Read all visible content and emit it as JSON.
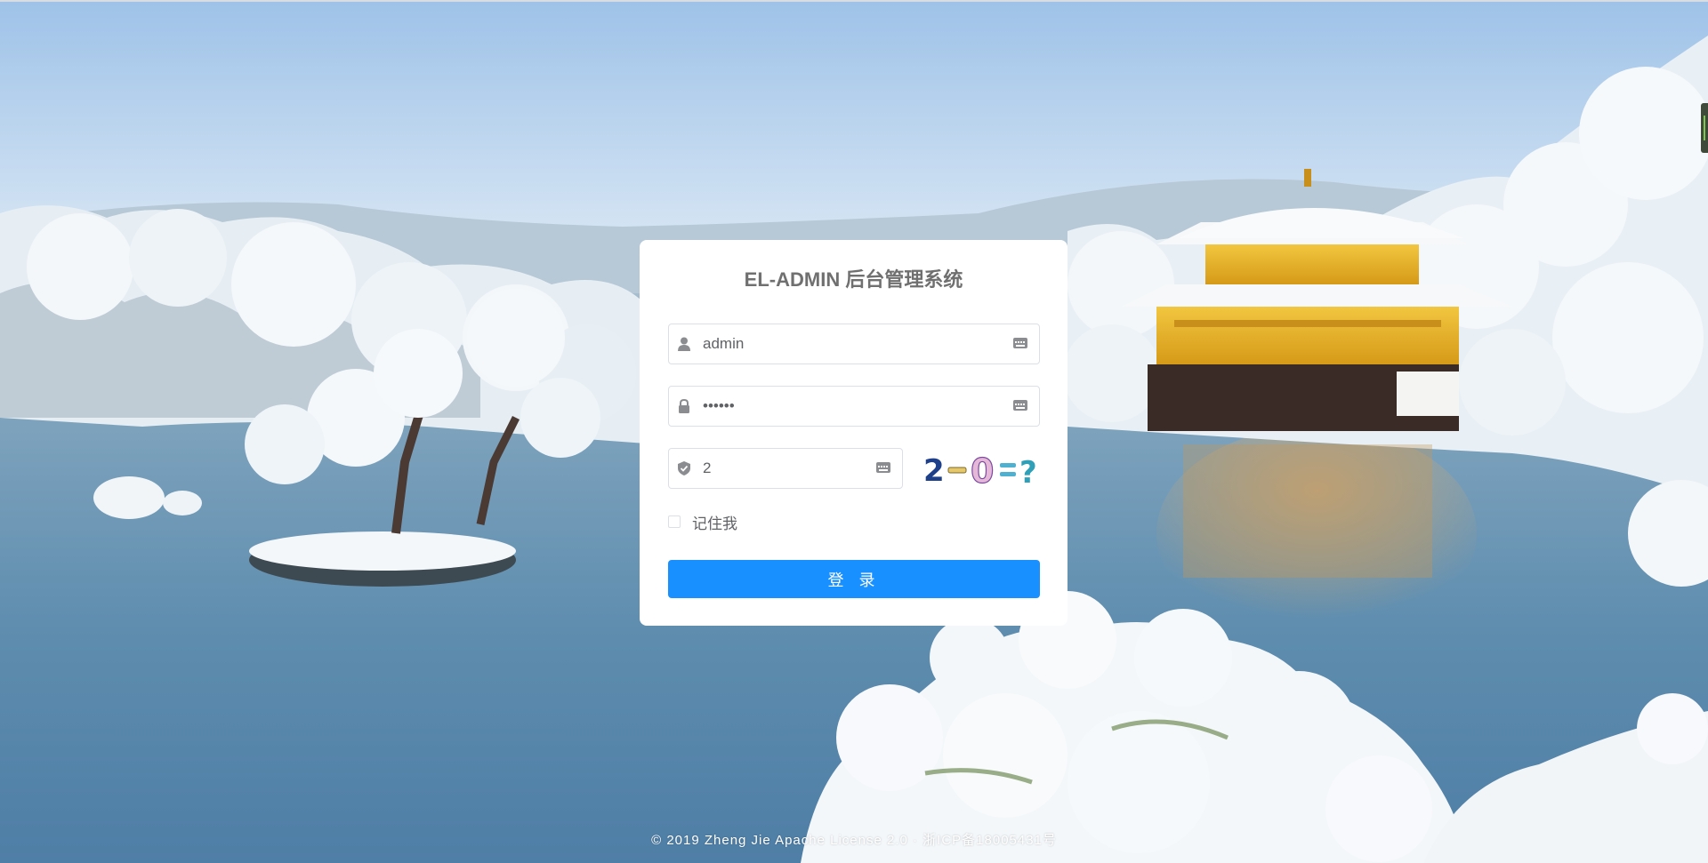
{
  "login": {
    "title": "EL-ADMIN 后台管理系统",
    "username_value": "admin",
    "password_value": "••••••",
    "code_value": "2",
    "captcha_text": "2-0=?",
    "remember_label": "记住我",
    "submit_label": "登 录"
  },
  "footer": {
    "text": "© 2019 Zheng Jie Apache License 2.0 · 浙ICP备18005431号"
  },
  "colors": {
    "primary": "#1890ff",
    "card": "#ffffff",
    "title": "#707070",
    "input_text": "#606266",
    "border": "#dcdfe6"
  },
  "icons": {
    "username": "user-icon",
    "password": "lock-icon",
    "code": "shield-icon",
    "suffix": "keyboard-icon"
  }
}
